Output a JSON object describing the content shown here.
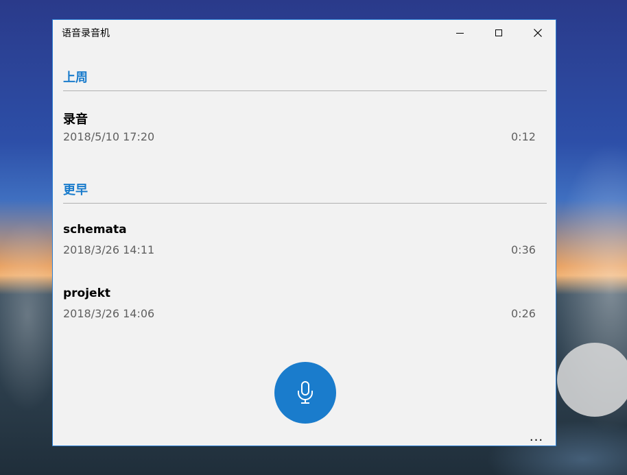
{
  "window": {
    "title": "语音录音机",
    "controls": {
      "minimize": "minimize-icon",
      "maximize": "maximize-icon",
      "close": "close-icon"
    }
  },
  "sections": [
    {
      "header": "上周",
      "recordings": [
        {
          "name": "录音",
          "date": "2018/5/10 17:20",
          "duration": "0:12"
        }
      ]
    },
    {
      "header": "更早",
      "recordings": [
        {
          "name": "schemata",
          "date": "2018/3/26 14:11",
          "duration": "0:36"
        },
        {
          "name": "projekt",
          "date": "2018/3/26 14:06",
          "duration": "0:26"
        }
      ]
    }
  ],
  "record_button": {
    "icon": "microphone-icon"
  },
  "more_button": {
    "label": "...",
    "icon": "more-icon"
  },
  "colors": {
    "accent": "#1a7ccc",
    "window_bg": "#f2f2f2",
    "border": "#2b7fd4"
  }
}
